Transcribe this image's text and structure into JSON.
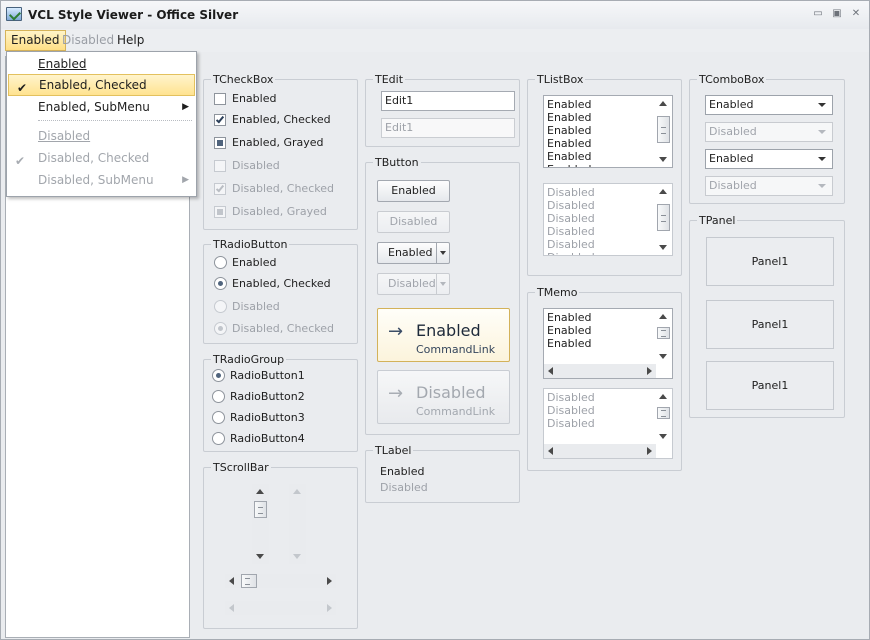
{
  "window": {
    "title": "VCL Style Viewer - Office Silver",
    "min_icon": "minimize-icon",
    "max_icon": "maximize-icon",
    "close_icon": "close-icon"
  },
  "menu": {
    "items": [
      {
        "label": "Enabled"
      },
      {
        "label": "Disabled"
      },
      {
        "label": "Help"
      }
    ],
    "popup": [
      {
        "label": "Enabled",
        "checked": false,
        "submenu": false,
        "disabled": false
      },
      {
        "label": "Enabled, Checked",
        "checked": true,
        "submenu": false,
        "disabled": false
      },
      {
        "label": "Enabled, SubMenu",
        "checked": false,
        "submenu": true,
        "disabled": false
      },
      {
        "label": "Disabled",
        "checked": false,
        "submenu": false,
        "disabled": true
      },
      {
        "label": "Disabled, Checked",
        "checked": true,
        "submenu": false,
        "disabled": true
      },
      {
        "label": "Disabled, SubMenu",
        "checked": false,
        "submenu": true,
        "disabled": true
      }
    ]
  },
  "checkbox": {
    "title": "TCheckBox",
    "items": [
      "Enabled",
      "Enabled, Checked",
      "Enabled, Grayed",
      "Disabled",
      "Disabled, Checked",
      "Disabled, Grayed"
    ]
  },
  "radio": {
    "title": "TRadioButton",
    "items": [
      "Enabled",
      "Enabled, Checked",
      "Disabled",
      "Disabled, Checked"
    ]
  },
  "radiogroup": {
    "title": "TRadioGroup",
    "items": [
      "RadioButton1",
      "RadioButton2",
      "RadioButton3",
      "RadioButton4"
    ]
  },
  "scrollbar": {
    "title": "TScrollBar"
  },
  "edit": {
    "title": "TEdit",
    "enabled_value": "Edit1",
    "disabled_value": "Edit1"
  },
  "button": {
    "title": "TButton",
    "enabled": "Enabled",
    "disabled": "Disabled",
    "split_enabled": "Enabled",
    "split_disabled": "Disabled",
    "cmd_enabled_main": "Enabled",
    "cmd_enabled_sub": "CommandLink",
    "cmd_disabled_main": "Disabled",
    "cmd_disabled_sub": "CommandLink",
    "arrow_glyph": "→"
  },
  "label": {
    "title": "TLabel",
    "enabled": "Enabled",
    "disabled": "Disabled"
  },
  "listbox": {
    "title": "TListBox",
    "enabled_items": [
      "Enabled",
      "Enabled",
      "Enabled",
      "Enabled",
      "Enabled",
      "Enabled"
    ],
    "disabled_items": [
      "Disabled",
      "Disabled",
      "Disabled",
      "Disabled",
      "Disabled",
      "Disabled"
    ]
  },
  "memo": {
    "title": "TMemo",
    "enabled_lines": [
      "Enabled",
      "Enabled",
      "Enabled"
    ],
    "disabled_lines": [
      "Disabled",
      "Disabled",
      "Disabled"
    ]
  },
  "combobox": {
    "title": "TComboBox",
    "values": [
      "Enabled",
      "Disabled",
      "Enabled",
      "Disabled"
    ]
  },
  "panel": {
    "title": "TPanel",
    "items": [
      "Panel1",
      "Panel1",
      "Panel1"
    ]
  },
  "colors": {
    "accent_highlight": "#ffdf86",
    "accent_border": "#d6b359",
    "disabled_text": "#9da1a8"
  }
}
